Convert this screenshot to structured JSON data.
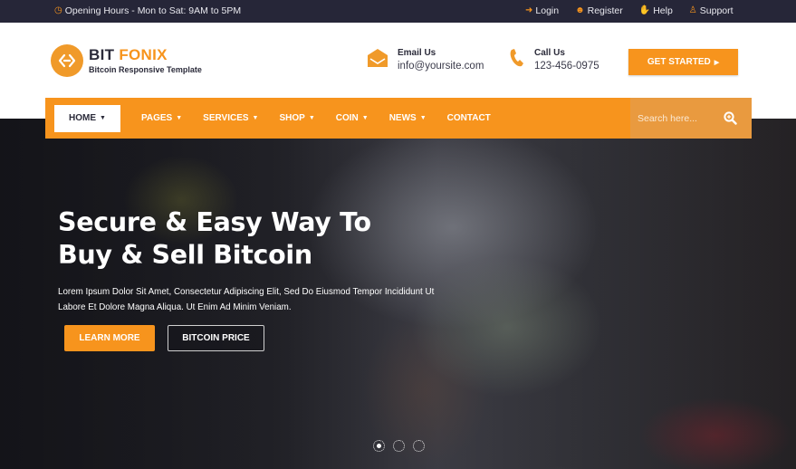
{
  "topbar": {
    "opening_hours": "Opening Hours - Mon to Sat: 9AM to 5PM",
    "links": [
      {
        "label": "Login",
        "icon": "login-icon"
      },
      {
        "label": "Register",
        "icon": "user-icon"
      },
      {
        "label": "Help",
        "icon": "hand-icon"
      },
      {
        "label": "Support",
        "icon": "support-icon"
      }
    ]
  },
  "header": {
    "logo": {
      "title_main": "BIT",
      "title_accent": "FONIX",
      "subtitle": "Bitcoin Responsive Template"
    },
    "email": {
      "label": "Email Us",
      "value": "info@yoursite.com"
    },
    "phone": {
      "label": "Call Us",
      "value": "123-456-0975"
    },
    "cta_label": "GET STARTED"
  },
  "nav": {
    "items": [
      {
        "label": "HOME",
        "dropdown": true,
        "active": true
      },
      {
        "label": "PAGES",
        "dropdown": true
      },
      {
        "label": "SERVICES",
        "dropdown": true
      },
      {
        "label": "SHOP",
        "dropdown": true
      },
      {
        "label": "COIN",
        "dropdown": true
      },
      {
        "label": "NEWS",
        "dropdown": true
      },
      {
        "label": "CONTACT",
        "dropdown": false
      }
    ],
    "search_placeholder": "Search here..."
  },
  "hero": {
    "title_line1": "Secure & Easy Way To",
    "title_line2": "Buy & Sell Bitcoin",
    "desc_line1": "Lorem Ipsum Dolor Sit Amet, Consectetur Adipiscing Elit, Sed Do Eiusmod Tempor Incididunt Ut",
    "desc_line2": "Labore Et Dolore Magna Aliqua. Ut Enim Ad Minim Veniam.",
    "primary_button": "LEARN MORE",
    "secondary_button": "BITCOIN PRICE",
    "slides": {
      "count": 3,
      "active": 1
    }
  },
  "colors": {
    "accent": "#f7941d",
    "topbar_bg": "#262638",
    "text_dark": "#2b2b3a"
  }
}
